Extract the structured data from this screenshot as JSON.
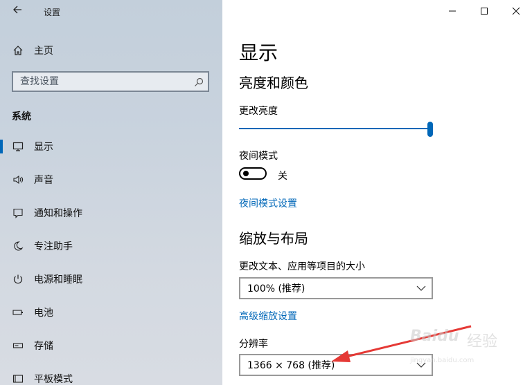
{
  "window": {
    "title": "设置",
    "accent": "#0067b8"
  },
  "sidebar": {
    "home_label": "主页",
    "search_placeholder": "查找设置",
    "section_title": "系统",
    "items": [
      {
        "label": "显示",
        "icon": "monitor-icon",
        "active": true
      },
      {
        "label": "声音",
        "icon": "speaker-icon"
      },
      {
        "label": "通知和操作",
        "icon": "notification-icon"
      },
      {
        "label": "专注助手",
        "icon": "moon-icon"
      },
      {
        "label": "电源和睡眠",
        "icon": "power-icon"
      },
      {
        "label": "电池",
        "icon": "battery-icon"
      },
      {
        "label": "存储",
        "icon": "storage-icon"
      },
      {
        "label": "平板模式",
        "icon": "tablet-icon"
      }
    ]
  },
  "main": {
    "page_title": "显示",
    "brightness_section": "亮度和颜色",
    "brightness_label": "更改亮度",
    "brightness_value": 1.0,
    "night_mode_label": "夜间模式",
    "night_mode_state": "关",
    "night_mode_link": "夜间模式设置",
    "scale_section": "缩放与布局",
    "scale_label": "更改文本、应用等项目的大小",
    "scale_value": "100% (推荐)",
    "advanced_scale_link": "高级缩放设置",
    "resolution_label": "分辨率",
    "resolution_value": "1366 × 768 (推荐)"
  },
  "watermark": {
    "logo": "Baidu",
    "text": "经验",
    "url": "jingyan.baidu.com"
  }
}
